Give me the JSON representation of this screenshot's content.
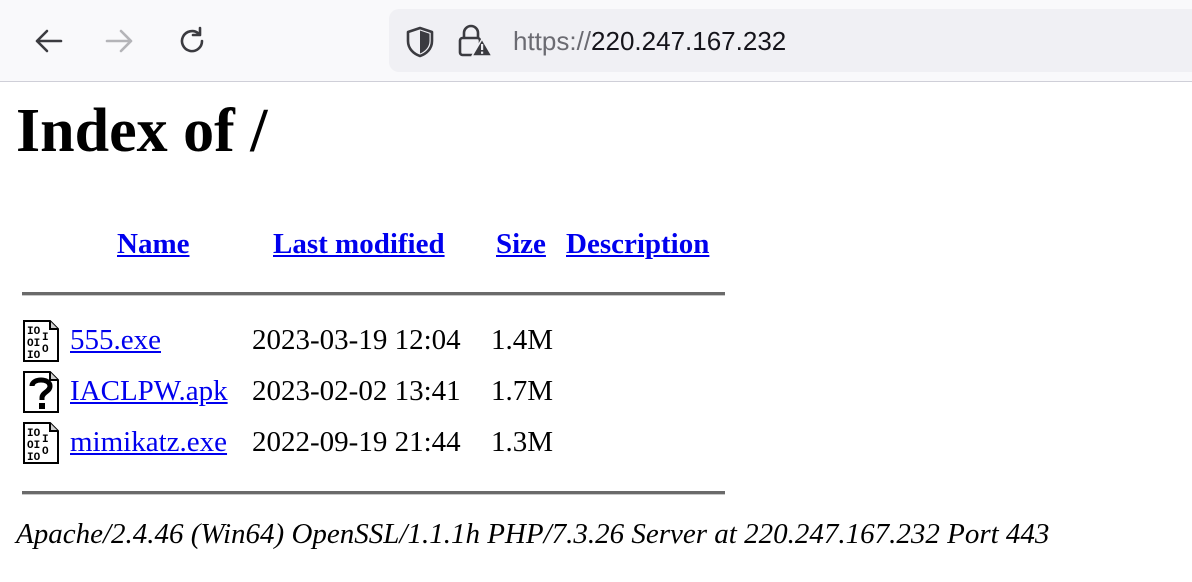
{
  "browser": {
    "url_scheme": "https://",
    "url_host": "220.247.167.232"
  },
  "page": {
    "title": "Index of /",
    "columns": {
      "name": "Name",
      "last_modified": "Last modified",
      "size": "Size",
      "description": "Description"
    },
    "files": [
      {
        "name": "555.exe",
        "modified": "2023-03-19 12:04",
        "size": "1.4M",
        "icon": "binary-file-icon"
      },
      {
        "name": "IACLPW.apk",
        "modified": "2023-02-02 13:41",
        "size": "1.7M",
        "icon": "unknown-file-icon"
      },
      {
        "name": "mimikatz.exe",
        "modified": "2022-09-19 21:44",
        "size": "1.3M",
        "icon": "binary-file-icon"
      }
    ],
    "footer": "Apache/2.4.46 (Win64) OpenSSL/1.1.1h PHP/7.3.26 Server at 220.247.167.232 Port 443"
  }
}
